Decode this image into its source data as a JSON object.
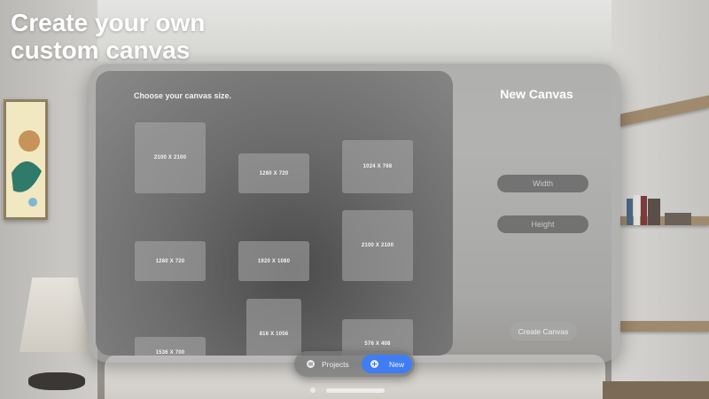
{
  "hero": {
    "title": "Create your own\ncustom canvas"
  },
  "grid": {
    "heading": "Choose your canvas size.",
    "sizes": [
      "2100 X 2100",
      "1280 X 720",
      "1024 X 768",
      "2100 X 2100",
      "1280 X 720",
      "1920 X 1080",
      "816 X 1056",
      "576 X 408",
      "1536 X 700"
    ]
  },
  "side": {
    "title": "New Canvas",
    "width_placeholder": "Width",
    "height_placeholder": "Height",
    "create_label": "Create Canvas"
  },
  "tabbar": {
    "projects_label": "Projects",
    "new_label": "New",
    "icons": {
      "projects": "list-icon",
      "new": "plus-circle-icon"
    }
  },
  "colors": {
    "accent": "#3f7ef2"
  }
}
